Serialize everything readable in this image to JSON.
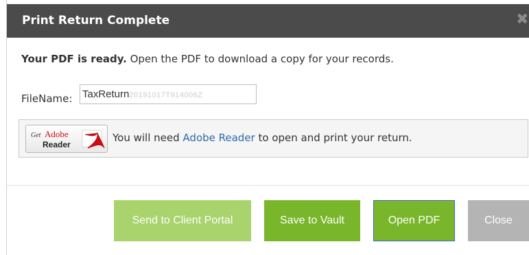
{
  "dialog": {
    "title": "Print Return Complete",
    "close_glyph": "✖"
  },
  "message": {
    "bold": "Your PDF is ready.",
    "rest": " Open the PDF to download a copy for your records."
  },
  "filename": {
    "label": "FileName:",
    "value_visible": "TaxReturn",
    "value_blurred": "20191017T914006Z"
  },
  "adobe": {
    "badge_get": "Get",
    "badge_adobe": "Adobe",
    "badge_reader": "Reader",
    "text_before": "You will need ",
    "link": "Adobe Reader",
    "text_after": " to open and print your return."
  },
  "buttons": {
    "send_portal": "Send to Client Portal",
    "save_vault": "Save to Vault",
    "open_pdf": "Open PDF",
    "close": "Close"
  },
  "colors": {
    "titlebar": "#4b4b4b",
    "button_green": "#79b62b",
    "button_green_disabled": "#a9d36d",
    "button_gray": "#b4b4b4",
    "link": "#2f6aa6",
    "adobe_red": "#d20a11"
  }
}
